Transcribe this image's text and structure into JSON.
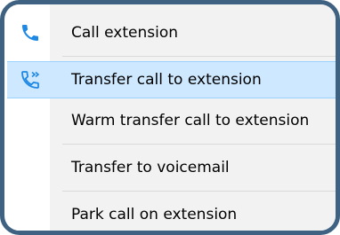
{
  "menu": {
    "items": [
      {
        "label": "Call extension",
        "icon": "phone-icon"
      },
      {
        "label": "Transfer call to extension",
        "icon": "phone-transfer-icon",
        "selected": true
      },
      {
        "label": "Warm transfer call to extension"
      },
      {
        "label": "Transfer to voicemail"
      },
      {
        "label": "Park call on extension"
      }
    ]
  },
  "colors": {
    "frame_border": "#3f6282",
    "icon_blue": "#1e88e5",
    "selected_bg": "#cde8ff",
    "selected_border": "#99d1ff",
    "menu_bg": "#f2f2f2",
    "separator": "#d9d9d9"
  }
}
